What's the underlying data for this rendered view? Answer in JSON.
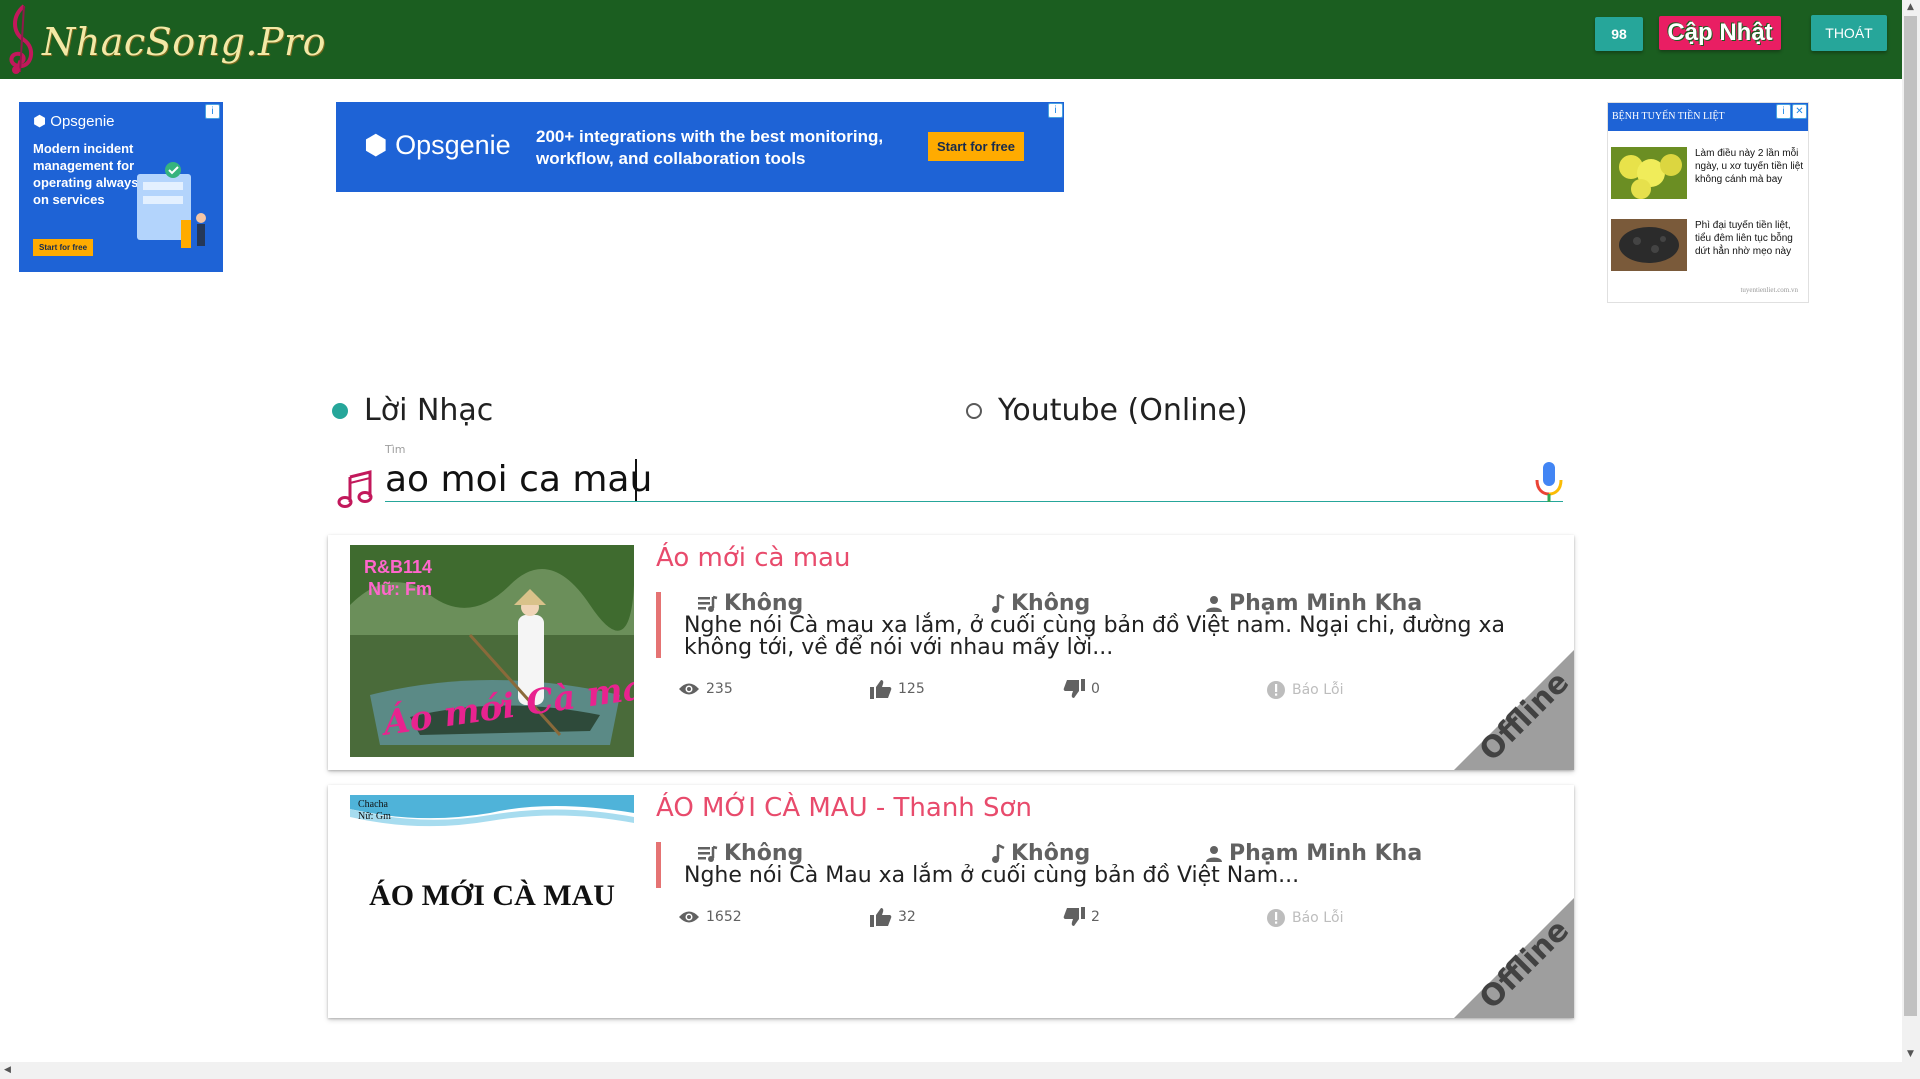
{
  "header": {
    "logo_text": "NhacSong.Pro",
    "count_badge": "98",
    "update_label": "Cập Nhật",
    "exit_label": "THOÁT"
  },
  "ads": {
    "left": {
      "brand": "Opsgenie",
      "text": "Modern incident management for operating always-on services",
      "cta": "Start for free"
    },
    "center": {
      "brand": "Opsgenie",
      "text": "200+ integrations with the best monitoring, workflow, and collaboration tools",
      "cta": "Start for free"
    },
    "right": {
      "header": "BỆNH TUYẾN TIỀN LIỆT",
      "items": [
        {
          "text": "Làm điều này 2 lần mỗi ngày, u xơ tuyến tiền liệt không cánh mà bay"
        },
        {
          "text": "Phì đại tuyến tiền liệt, tiểu đêm liên tục bỗng dứt hẳn nhờ mẹo này"
        }
      ],
      "source": "tuyentienliet.com.vn"
    }
  },
  "search_mode": {
    "options": [
      {
        "label": "Lời Nhạc",
        "selected": true
      },
      {
        "label": "Youtube (Online)",
        "selected": false
      }
    ]
  },
  "search": {
    "label": "Tìm",
    "value": "ao moi ca mau"
  },
  "results": [
    {
      "title": "Áo mới cà mau",
      "thumb_tag1": "R&B114",
      "thumb_tag2": "Nữ: Fm",
      "thumb_caption": "Áo mới Cà mau",
      "rhythm": "Không",
      "tone": "Không",
      "author": "Phạm Minh Kha",
      "excerpt": "Nghe nói Cà mau xa lắm, ở cuối cùng bản đồ Việt nam. Ngại chi, đường xa không tới, về để nói với nhau mấy lời...",
      "views": "235",
      "likes": "125",
      "dislikes": "0",
      "report_label": "Báo Lỗi",
      "badge": "Offline"
    },
    {
      "title": "ÁO MỚI CÀ MAU - Thanh Sơn",
      "thumb_tag1": "Chacha",
      "thumb_tag2": "Nữ: Gm",
      "thumb_caption": "ÁO MỚI CÀ MAU",
      "rhythm": "Không",
      "tone": "Không",
      "author": "Phạm Minh Kha",
      "excerpt": "Nghe nói Cà Mau xa lắm ở cuối cùng bản đồ Việt Nam...",
      "views": "1652",
      "likes": "32",
      "dislikes": "2",
      "report_label": "Báo Lỗi",
      "badge": "Offline"
    }
  ],
  "colors": {
    "header_bg": "#1b5e20",
    "accent_teal": "#26a69a",
    "accent_pink": "#e91e63",
    "title_pink": "#e84b6c",
    "ad_blue": "#1e63d6"
  }
}
